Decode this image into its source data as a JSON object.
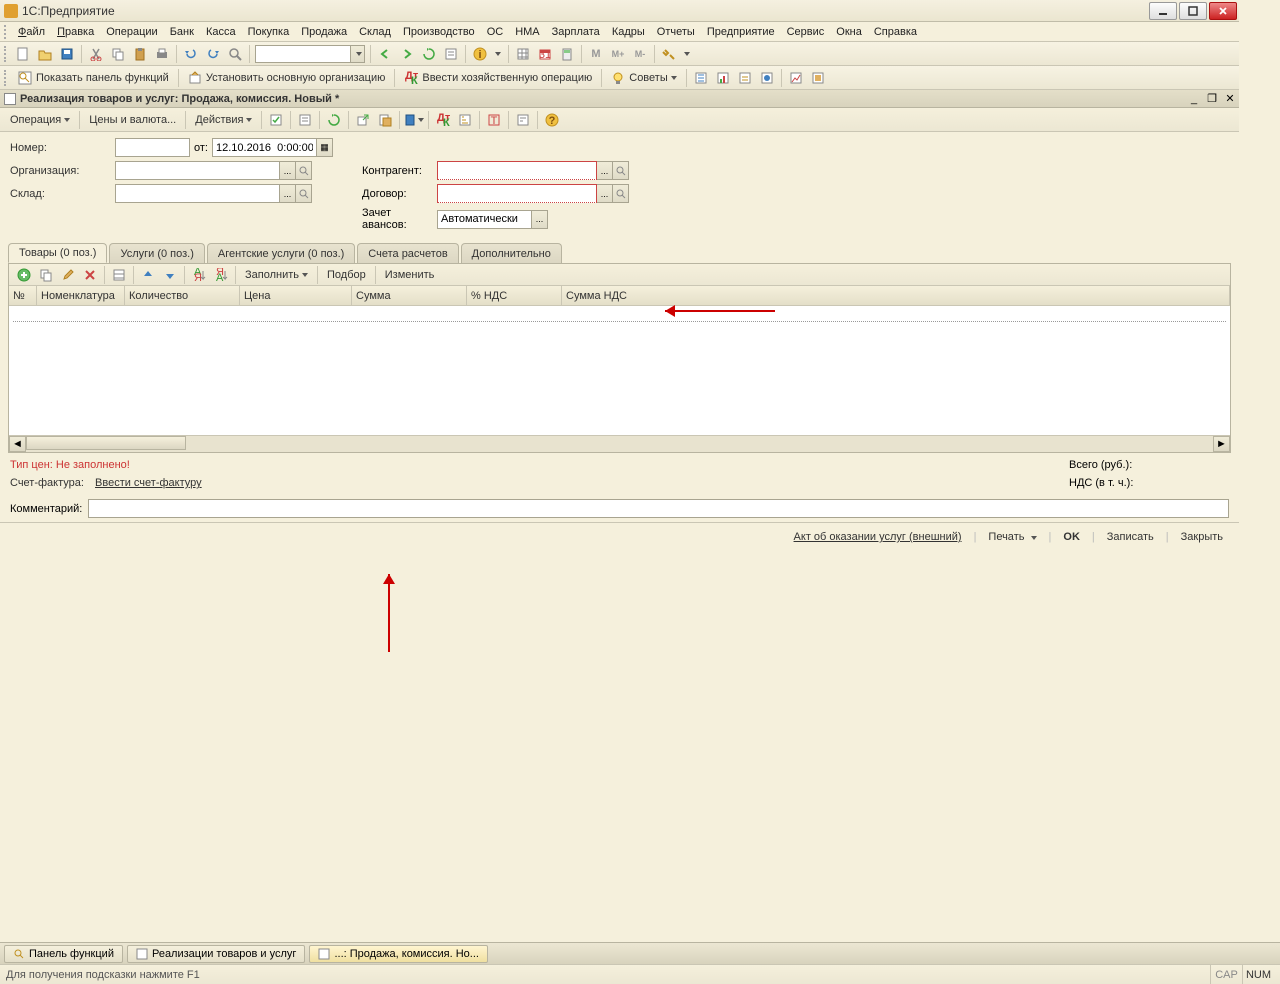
{
  "window": {
    "title": "1С:Предприятие"
  },
  "menu": [
    "Файл",
    "Правка",
    "Операции",
    "Банк",
    "Касса",
    "Покупка",
    "Продажа",
    "Склад",
    "Производство",
    "ОС",
    "НМА",
    "Зарплата",
    "Кадры",
    "Отчеты",
    "Предприятие",
    "Сервис",
    "Окна",
    "Справка"
  ],
  "toolbar2": {
    "show_panel": "Показать панель функций",
    "set_org": "Установить основную организацию",
    "enter_op": "Ввести хозяйственную операцию",
    "advice": "Советы"
  },
  "doc": {
    "title": "Реализация товаров и услуг: Продажа, комиссия. Новый *"
  },
  "doc_toolbar": {
    "operation": "Операция",
    "prices": "Цены и валюта...",
    "actions": "Действия"
  },
  "form": {
    "number_label": "Номер:",
    "date_label": "от:",
    "date_value": "12.10.2016  0:00:00",
    "org_label": "Организация:",
    "warehouse_label": "Склад:",
    "contragent_label": "Контрагент:",
    "contract_label": "Договор:",
    "advance_label": "Зачет авансов:",
    "advance_value": "Автоматически"
  },
  "tabs": [
    "Товары (0 поз.)",
    "Услуги (0 поз.)",
    "Агентские услуги (0 поз.)",
    "Счета расчетов",
    "Дополнительно"
  ],
  "tab_toolbar": {
    "fill": "Заполнить",
    "select": "Подбор",
    "change": "Изменить"
  },
  "grid_cols": [
    "№",
    "Номенклатура",
    "Количество",
    "Цена",
    "Сумма",
    "% НДС",
    "Сумма НДС"
  ],
  "info": {
    "pricetype": "Тип цен: Не заполнено!",
    "invoice_label": "Счет-фактура:",
    "invoice_link": "Ввести счет-фактуру",
    "total_label": "Всего (руб.):",
    "vat_label": "НДС (в т. ч.):"
  },
  "comment_label": "Комментарий:",
  "footer": {
    "act": "Акт об оказании услуг (внешний)",
    "print": "Печать",
    "ok": "OK",
    "save": "Записать",
    "close": "Закрыть"
  },
  "taskbar": {
    "panel": "Панель функций",
    "list": "Реализации товаров и услуг",
    "doc": "...: Продажа, комиссия. Но..."
  },
  "status": {
    "hint": "Для получения подсказки нажмите F1",
    "cap": "CAP",
    "num": "NUM"
  }
}
